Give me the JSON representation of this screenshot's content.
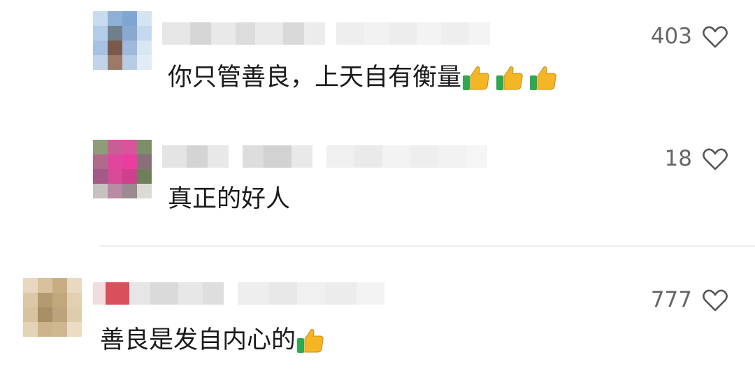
{
  "comments": [
    {
      "text": "你只管善良，上天自有衡量",
      "emoji": [
        "thumbs-up-icon",
        "thumbs-up-icon",
        "thumbs-up-icon"
      ],
      "likes": "403"
    },
    {
      "text": "真正的好人",
      "emoji": [],
      "likes": "18"
    },
    {
      "text": "善良是发自内心的",
      "emoji": [
        "thumbs-up-icon"
      ],
      "likes": "777"
    }
  ],
  "colors": {
    "text": "#1a1a1a",
    "like_count": "#666666",
    "heart_outline": "#555555",
    "divider": "#ededed",
    "thumb_yellow": "#f5b625",
    "thumb_green": "#2fa84f"
  },
  "icons": {
    "like": "heart-outline-icon",
    "emoji": "thumbs-up-icon"
  }
}
